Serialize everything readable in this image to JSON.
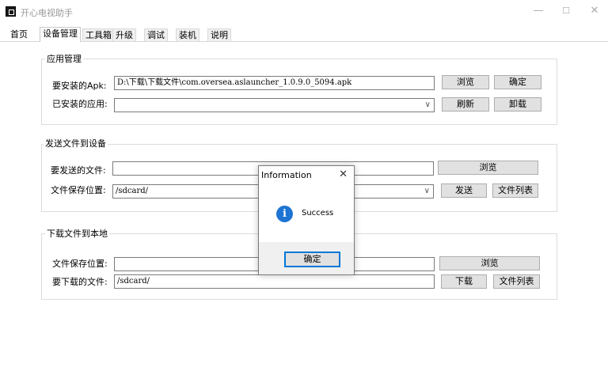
{
  "window": {
    "title": "开心电视助手",
    "minimize": "—",
    "maximize": "☐",
    "close": "✕"
  },
  "tabs": [
    {
      "label": "首页"
    },
    {
      "label": "设备管理"
    },
    {
      "label": "工具箱"
    },
    {
      "label": "升级"
    },
    {
      "label": "调试"
    },
    {
      "label": "装机"
    },
    {
      "label": "说明"
    }
  ],
  "app_mgmt": {
    "title": "应用管理",
    "apk_label": "要安装的Apk:",
    "apk_value": "D:\\下载\\下载文件\\com.oversea.aslauncher_1.0.9.0_5094.apk",
    "browse": "浏览",
    "confirm": "确定",
    "installed_label": "已安装的应用:",
    "installed_value": "",
    "refresh": "刷新",
    "uninstall": "卸载"
  },
  "send_file": {
    "title": "发送文件到设备",
    "file_label": "要发送的文件:",
    "file_value": "",
    "browse": "浏览",
    "save_label": "文件保存位置:",
    "save_value": "/sdcard/",
    "send": "发送",
    "file_list": "文件列表"
  },
  "download_file": {
    "title": "下载文件到本地",
    "save_label": "文件保存位置:",
    "save_value": "",
    "browse": "浏览",
    "file_label": "要下载的文件:",
    "file_value": "/sdcard/",
    "download": "下载",
    "file_list": "文件列表"
  },
  "dialog": {
    "title": "Information",
    "close": "✕",
    "icon": "info-icon",
    "icon_glyph": "i",
    "message": "Success",
    "ok": "确定"
  },
  "colors": {
    "info_blue": "#1e74d2",
    "focus_border": "#0078d7",
    "button_bg": "#e1e1e1"
  }
}
